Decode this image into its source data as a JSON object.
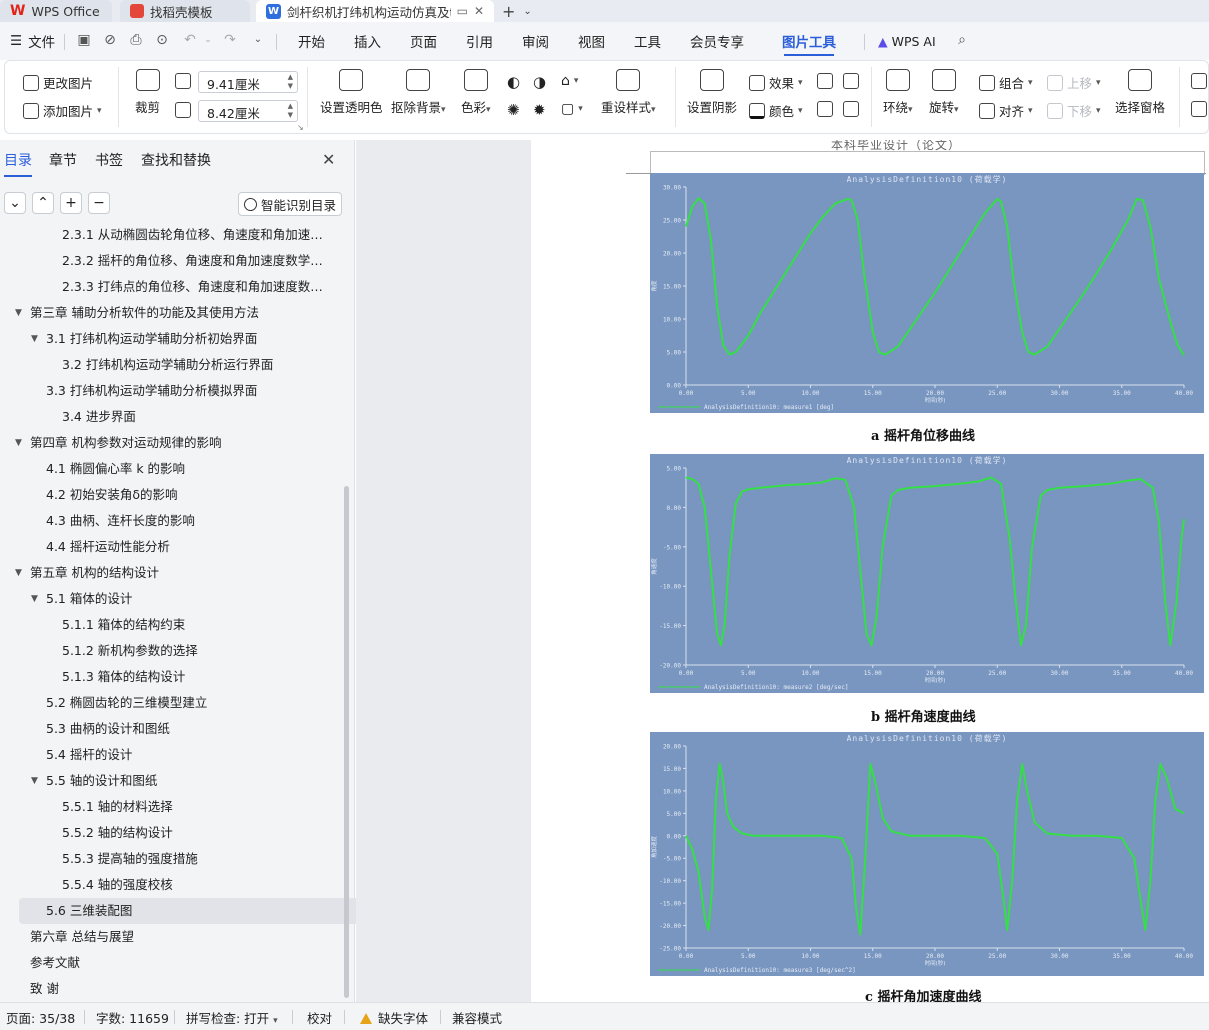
{
  "tabs": {
    "wps": "WPS Office",
    "template": "找稻壳模板",
    "doc": "剑杆织机打纬机构运动仿真及t"
  },
  "menu": {
    "file": "文件",
    "items": [
      "开始",
      "插入",
      "页面",
      "引用",
      "审阅",
      "视图",
      "工具",
      "会员专享",
      "图片工具"
    ],
    "wps_ai": "WPS AI"
  },
  "ribbon": {
    "change_image": "更改图片",
    "add_image": "添加图片",
    "crop": "裁剪",
    "width": "9.41厘米",
    "height": "8.42厘米",
    "set_transparent": "设置透明色",
    "remove_bg": "抠除背景",
    "color": "色彩",
    "reset_style": "重设样式",
    "shadow": "设置阴影",
    "effect": "效果",
    "fill_color": "颜色",
    "wrap": "环绕",
    "rotate": "旋转",
    "group": "组合",
    "align": "对齐",
    "move_up": "上移",
    "move_down": "下移",
    "select_pane": "选择窗格"
  },
  "panel": {
    "tabs": [
      "目录",
      "章节",
      "书签",
      "查找和替换"
    ],
    "smart_toc": "智能识别目录",
    "toc": [
      "2.3.1 从动椭圆齿轮角位移、角速度和角加速度数学模型",
      "2.3.2 摇杆的角位移、角速度和角加速度数学模型",
      "2.3.3  打纬点的角位移、角速度和角加速度数学模型",
      "第三章  辅助分析软件的功能及其使用方法",
      "3.1  打纬机构运动学辅助分析初始界面",
      "3.2 打纬机构运动学辅助分析运行界面",
      "3.3  打纬机构运动学辅助分析模拟界面",
      "3.4 进步界面",
      "第四章  机构参数对运动规律的影响",
      "4.1  椭圆偏心率 k 的影响",
      "4.2  初始安装角δ的影响",
      "4.3  曲柄、连杆长度的影响",
      "4.4  摇杆运动性能分析",
      "第五章  机构的结构设计",
      "5.1  箱体的设计",
      "5.1.1  箱体的结构约束",
      "5.1.2  新机构参数的选择",
      "5.1.3  箱体的结构设计",
      "5.2  椭圆齿轮的三维模型建立",
      "5.3  曲柄的设计和图纸",
      "5.4  摇杆的设计",
      "5.5 轴的设计和图纸",
      "5.5.1  轴的材料选择",
      "5.5.2  轴的结构设计",
      "5.5.3 提高轴的强度措施",
      "5.5.4  轴的强度校核",
      "5.6  三维装配图",
      "第六章  总结与展望",
      "参考文献",
      "致    谢"
    ]
  },
  "doc": {
    "header": "本科毕业设计（论文）",
    "captions": [
      "a  摇杆角位移曲线",
      "b  摇杆角速度曲线",
      "c  摇杆角加速度曲线"
    ]
  },
  "status": {
    "page": "页面: 35/38",
    "words": "字数: 11659",
    "spell": "拼写检查: 打开",
    "proof": "校对",
    "missing_font": "缺失字体",
    "compat": "兼容模式"
  },
  "chart_data": [
    {
      "type": "line",
      "title": "AnalysisDefinition10 (荷载学)",
      "xlabel": "时间(秒)",
      "ylabel": "角度",
      "legend": "AnalysisDefinition10: measure1 [deg]",
      "xlim": [
        0,
        40
      ],
      "ylim": [
        0,
        30
      ],
      "xticks": [
        "0.00",
        "5.00",
        "10.00",
        "15.00",
        "20.00",
        "25.00",
        "30.00",
        "35.00",
        "40.00"
      ],
      "yticks": [
        "0.00",
        "5.00",
        "10.00",
        "15.00",
        "20.00",
        "25.00",
        "30.00"
      ],
      "series": [
        {
          "color": "#33e045",
          "x": [
            0,
            0.5,
            1.0,
            1.5,
            2.0,
            2.5,
            3.0,
            3.5,
            4.0,
            5.0,
            6.0,
            7.0,
            8.0,
            9.0,
            10.0,
            11.0,
            12.0,
            13.0,
            13.3,
            13.8,
            14.3,
            15.0,
            15.5,
            16.0,
            17.0,
            18.0,
            20.0,
            22.0,
            24.0,
            25.0,
            25.3,
            25.8,
            26.3,
            27.0,
            27.5,
            28.0,
            29.0,
            30.0,
            32.0,
            34.0,
            35.5,
            36.2,
            36.7,
            37.3,
            38.0,
            39.0,
            39.5,
            40.0
          ],
          "y": [
            24,
            27,
            28.3,
            27.5,
            22,
            12,
            6,
            4.6,
            5.0,
            7.5,
            11,
            14,
            17,
            20,
            23,
            25.5,
            27.5,
            28.2,
            28,
            25,
            17,
            8,
            5.0,
            4.6,
            5.8,
            8.5,
            14,
            20,
            26,
            28.2,
            27.8,
            24,
            16,
            8,
            5.0,
            4.6,
            5.8,
            8.5,
            14,
            20,
            25,
            28.2,
            28,
            24,
            16,
            9,
            6,
            4.5
          ]
        }
      ]
    },
    {
      "type": "line",
      "title": "AnalysisDefinition10 (荷载学)",
      "xlabel": "时间(秒)",
      "ylabel": "角速度",
      "legend": "AnalysisDefinition10: measure2 [deg/sec]",
      "xlim": [
        0,
        40
      ],
      "ylim": [
        -20,
        5
      ],
      "xticks": [
        "0.00",
        "5.00",
        "10.00",
        "15.00",
        "20.00",
        "25.00",
        "30.00",
        "35.00",
        "40.00"
      ],
      "yticks": [
        "-20.00",
        "-15.00",
        "-10.00",
        "-5.00",
        "0.00",
        "5.00"
      ],
      "series": [
        {
          "color": "#33e045",
          "x": [
            0,
            0.5,
            1.0,
            1.5,
            2.0,
            2.5,
            2.8,
            3.1,
            3.5,
            4.0,
            4.5,
            5.0,
            6.0,
            8.0,
            10.0,
            11.0,
            12.0,
            12.8,
            13.5,
            14.0,
            14.5,
            14.9,
            15.3,
            15.8,
            16.5,
            17.0,
            18.0,
            20.0,
            22.0,
            23.5,
            24.5,
            25.3,
            26.0,
            26.5,
            26.9,
            27.3,
            27.8,
            28.5,
            29.0,
            30.0,
            32.0,
            34.0,
            35.5,
            36.5,
            37.5,
            38.0,
            38.5,
            38.9,
            39.4,
            39.8,
            40.0
          ],
          "y": [
            3.8,
            3.6,
            3.0,
            0,
            -8,
            -16,
            -17.5,
            -15,
            -6,
            0.5,
            2.0,
            2.3,
            2.5,
            2.8,
            3.0,
            3.2,
            3.7,
            3.5,
            0,
            -8,
            -16,
            -17.5,
            -14,
            -5,
            1.5,
            2.2,
            2.5,
            2.7,
            3.0,
            3.3,
            3.8,
            3.0,
            -4,
            -12,
            -17.5,
            -15,
            -5,
            1.5,
            2.2,
            2.5,
            2.7,
            3.0,
            3.4,
            3.6,
            2.5,
            -2,
            -12,
            -17.5,
            -12,
            -4,
            -1.5
          ]
        }
      ]
    },
    {
      "type": "line",
      "title": "AnalysisDefinition10 (荷载学)",
      "xlabel": "时间(秒)",
      "ylabel": "角加速度",
      "legend": "AnalysisDefinition10: measure3 [deg/sec^2]",
      "xlim": [
        0,
        40
      ],
      "ylim": [
        -25,
        20
      ],
      "xticks": [
        "0.00",
        "5.00",
        "10.00",
        "15.00",
        "20.00",
        "25.00",
        "30.00",
        "35.00",
        "40.00"
      ],
      "yticks": [
        "-25.00",
        "-20.00",
        "-15.00",
        "-10.00",
        "-5.00",
        "0.00",
        "5.00",
        "10.00",
        "15.00",
        "20.00"
      ],
      "series": [
        {
          "color": "#33e045",
          "x": [
            0,
            0.5,
            1.0,
            1.5,
            1.8,
            2.1,
            2.4,
            2.7,
            3.0,
            3.3,
            3.8,
            4.5,
            5.5,
            7.0,
            9.0,
            11.0,
            12.5,
            13.3,
            13.7,
            14.0,
            14.4,
            14.8,
            15.2,
            15.8,
            16.5,
            18.0,
            20.0,
            22.0,
            24.0,
            25.0,
            25.5,
            25.8,
            26.2,
            26.6,
            27.0,
            27.4,
            28.0,
            29.0,
            31.0,
            33.0,
            35.0,
            36.0,
            36.5,
            36.9,
            37.3,
            37.7,
            38.1,
            38.6,
            39.3,
            40.0
          ],
          "y": [
            0,
            -3,
            -8,
            -18,
            -21,
            -12,
            8,
            16,
            12,
            5,
            2,
            0.5,
            0,
            0,
            0,
            0,
            -0.5,
            -5,
            -17,
            -22,
            -5,
            16,
            12,
            4,
            1,
            0,
            0,
            0,
            -0.5,
            -4,
            -14,
            -21,
            -10,
            8,
            16,
            10,
            3,
            0.5,
            0,
            0,
            -0.5,
            -5,
            -14,
            -21,
            -10,
            8,
            16,
            13,
            6,
            5
          ]
        }
      ]
    }
  ]
}
